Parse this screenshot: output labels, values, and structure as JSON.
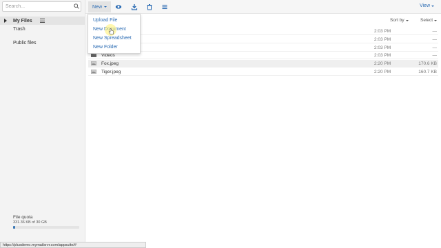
{
  "search": {
    "placeholder": "Search..."
  },
  "sidebar": {
    "items": [
      {
        "label": "My Files"
      },
      {
        "label": "Trash"
      },
      {
        "label": "Public files"
      }
    ],
    "quota": {
      "label": "File quota",
      "value": "331.36 KB of 30 GB",
      "fraction": 1e-05
    }
  },
  "status_bar": {
    "url": "https://plusdemo.mymailsrvr.com/appsuite/#"
  },
  "toolbar": {
    "new_label": "New",
    "view_label": "View",
    "icons": [
      "eye-icon",
      "download-icon",
      "trash-icon",
      "menu-icon"
    ]
  },
  "list_header": {
    "sort_label": "Sort by",
    "select_label": "Select"
  },
  "new_menu": {
    "items": [
      "Upload File",
      "New Document",
      "New Spreadsheet",
      "New Folder"
    ]
  },
  "files": [
    {
      "name": "",
      "date": "2:03 PM",
      "size": "—"
    },
    {
      "name": "",
      "date": "2:03 PM",
      "size": "—"
    },
    {
      "name": "",
      "date": "2:03 PM",
      "size": "—"
    },
    {
      "name": "Videos",
      "date": "2:03 PM",
      "size": "—"
    },
    {
      "name": "Fox.jpeg",
      "date": "2:20 PM",
      "size": "170.6 KB"
    },
    {
      "name": "Tiger.jpeg",
      "date": "2:20 PM",
      "size": "160.7 KB"
    }
  ],
  "colors": {
    "accent": "#2a6bb3",
    "sidebar_bg": "#f3f3f3",
    "quota_fill": "#3a78b5"
  }
}
